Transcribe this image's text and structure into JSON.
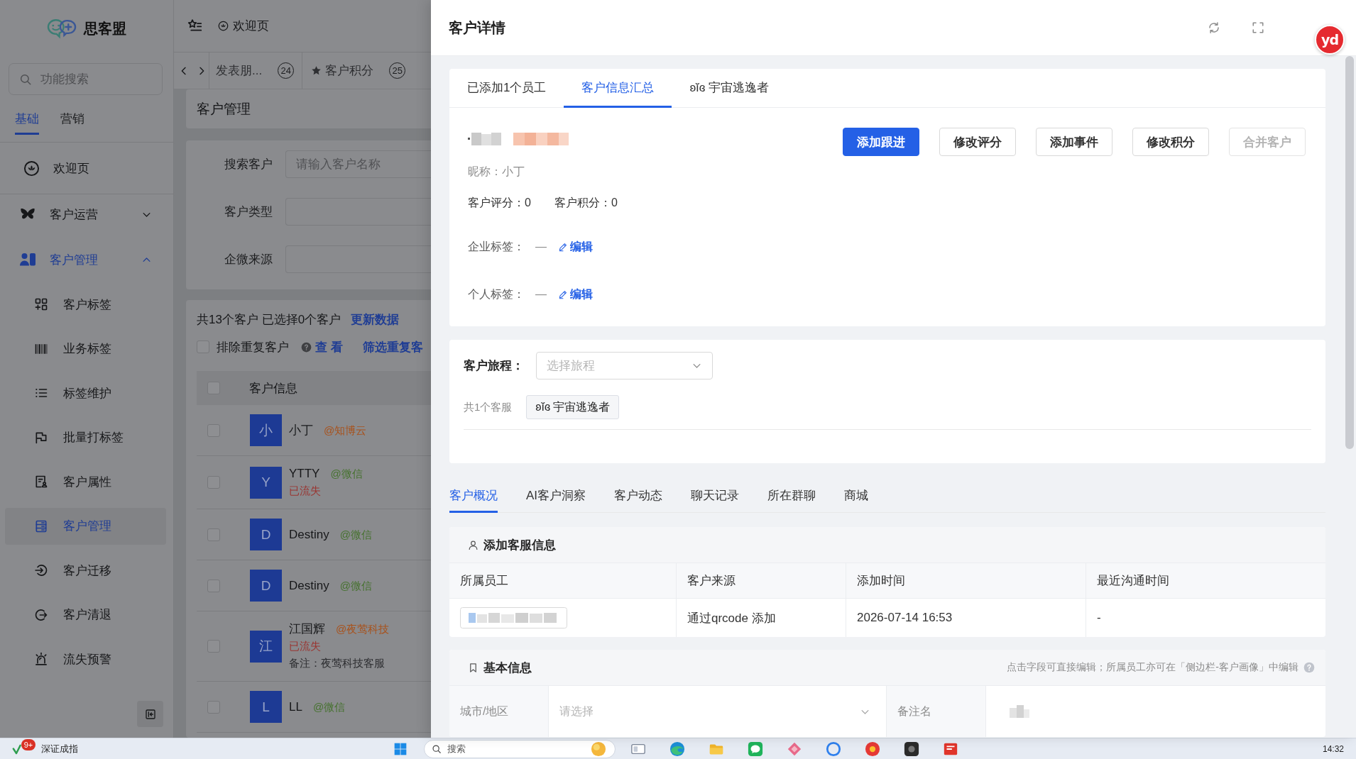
{
  "sidebar": {
    "logo": "思客盟",
    "search": {
      "placeholder": "功能搜索"
    },
    "tabs": [
      {
        "label": "基础",
        "selected": true
      },
      {
        "label": "营销",
        "selected": false
      }
    ],
    "items": [
      {
        "kind": "link",
        "label": "欢迎页",
        "selected": false
      },
      {
        "kind": "group",
        "label": "客户运营",
        "expanded": false
      },
      {
        "kind": "group",
        "label": "客户管理",
        "expanded": true,
        "children": [
          {
            "label": "客户标签",
            "selected": false
          },
          {
            "label": "业务标签",
            "selected": false
          },
          {
            "label": "标签维护",
            "selected": false
          },
          {
            "label": "批量打标签",
            "selected": false
          },
          {
            "label": "客户属性",
            "selected": false
          },
          {
            "label": "客户管理",
            "selected": true
          },
          {
            "label": "客户迁移",
            "selected": false
          },
          {
            "label": "客户清退",
            "selected": false
          },
          {
            "label": "流失预警",
            "selected": false
          }
        ]
      }
    ]
  },
  "topbar": {
    "home": "欢迎页",
    "tabs": [
      {
        "kind": "plain",
        "label": "发表朋...",
        "count": "24",
        "selected": false
      },
      {
        "kind": "starred",
        "label": "客户积分",
        "count": "25",
        "selected": false
      }
    ]
  },
  "page": {
    "title": "客户管理",
    "filters": [
      {
        "label": "搜索客户",
        "placeholder": "请输入客户名称"
      },
      {
        "label": "客户类型"
      },
      {
        "label": "企微来源"
      }
    ],
    "summary": "共13个客户 已选择0个客户",
    "refresh_link": "更新数据",
    "dedupe": {
      "label": "排除重复客户",
      "checked": false
    },
    "links": [
      "查 看",
      "筛选重复客"
    ],
    "table": {
      "checked": false,
      "columns": [
        "客户信息"
      ],
      "rows": [
        {
          "checked": false,
          "avatar": "小",
          "name": "小丁",
          "source": {
            "text": "@知博云",
            "color": "#a8521c"
          }
        },
        {
          "checked": false,
          "avatar": "Y",
          "name": "YTTY",
          "source": {
            "text": "@微信",
            "color": "#46722f"
          },
          "status": "已流失"
        },
        {
          "checked": false,
          "avatar": "D",
          "name": "Destiny",
          "source": {
            "text": "@微信",
            "color": "#46722f"
          }
        },
        {
          "checked": false,
          "avatar": "D",
          "name": "Destiny",
          "source": {
            "text": "@微信",
            "color": "#46722f"
          }
        },
        {
          "checked": false,
          "avatar": "江",
          "name": "江国辉",
          "source": {
            "text": "@夜莺科技",
            "color": "#a8521c"
          },
          "status": "已流失",
          "note": "备注：夜莺科技客服"
        },
        {
          "checked": false,
          "avatar": "L",
          "name": "LL",
          "source": {
            "text": "@微信",
            "color": "#46722f"
          }
        }
      ]
    }
  },
  "drawer": {
    "title": "客户详情",
    "tabs": [
      {
        "label": "已添加1个员工",
        "selected": false
      },
      {
        "label": "客户信息汇总",
        "selected": true
      },
      {
        "label": "ʚĭɞ 宇宙逃逸者",
        "selected": false
      }
    ],
    "actions": [
      {
        "kind": "primary",
        "label": "添加跟进",
        "disabled": false
      },
      {
        "kind": "default",
        "label": "修改评分",
        "disabled": false
      },
      {
        "kind": "default",
        "label": "添加事件",
        "disabled": false
      },
      {
        "kind": "default",
        "label": "修改积分",
        "disabled": false
      },
      {
        "kind": "default",
        "label": "合并客户",
        "disabled": true
      }
    ],
    "nickname": "昵称：小丁",
    "scores": [
      "客户评分：0",
      "客户积分：0"
    ],
    "tag_rows": [
      {
        "label": "企业标签：",
        "value": "—",
        "edit": "编辑"
      },
      {
        "label": "个人标签：",
        "value": "—",
        "edit": "编辑"
      }
    ],
    "journey": {
      "label": "客户旅程：",
      "placeholder": "选择旅程",
      "staff_count": "共1个客服",
      "staff": [
        "ʚĭɞ 宇宙逃逸者"
      ]
    },
    "detail_tabs": [
      {
        "label": "客户概况",
        "selected": true
      },
      {
        "label": "AI客户洞察",
        "selected": false
      },
      {
        "label": "客户动态",
        "selected": false
      },
      {
        "label": "聊天记录",
        "selected": false
      },
      {
        "label": "所在群聊",
        "selected": false
      },
      {
        "label": "商城",
        "selected": false
      }
    ],
    "service_info": {
      "title": "添加客服信息",
      "columns": [
        "所属员工",
        "客户来源",
        "添加时间",
        "最近沟通时间"
      ],
      "rows": [
        {
          "source": "通过qrcode 添加",
          "added_at": "2026-07-14 16:53",
          "last_contact": "-"
        }
      ]
    },
    "basic_info": {
      "title": "基本信息",
      "hint": "点击字段可直接编辑；所属员工亦可在「侧边栏-客户画像」中编辑",
      "fields": [
        {
          "kind": "select",
          "label": "城市/地区",
          "placeholder": "请选择"
        },
        {
          "kind": "redacted",
          "label": "备注名"
        }
      ]
    }
  },
  "floating_widget": {
    "label": "yd"
  },
  "taskbar": {
    "widget": {
      "badge": "9+",
      "label": "深证成指"
    },
    "search": {
      "placeholder": "搜索"
    },
    "clock": "14:32"
  }
}
